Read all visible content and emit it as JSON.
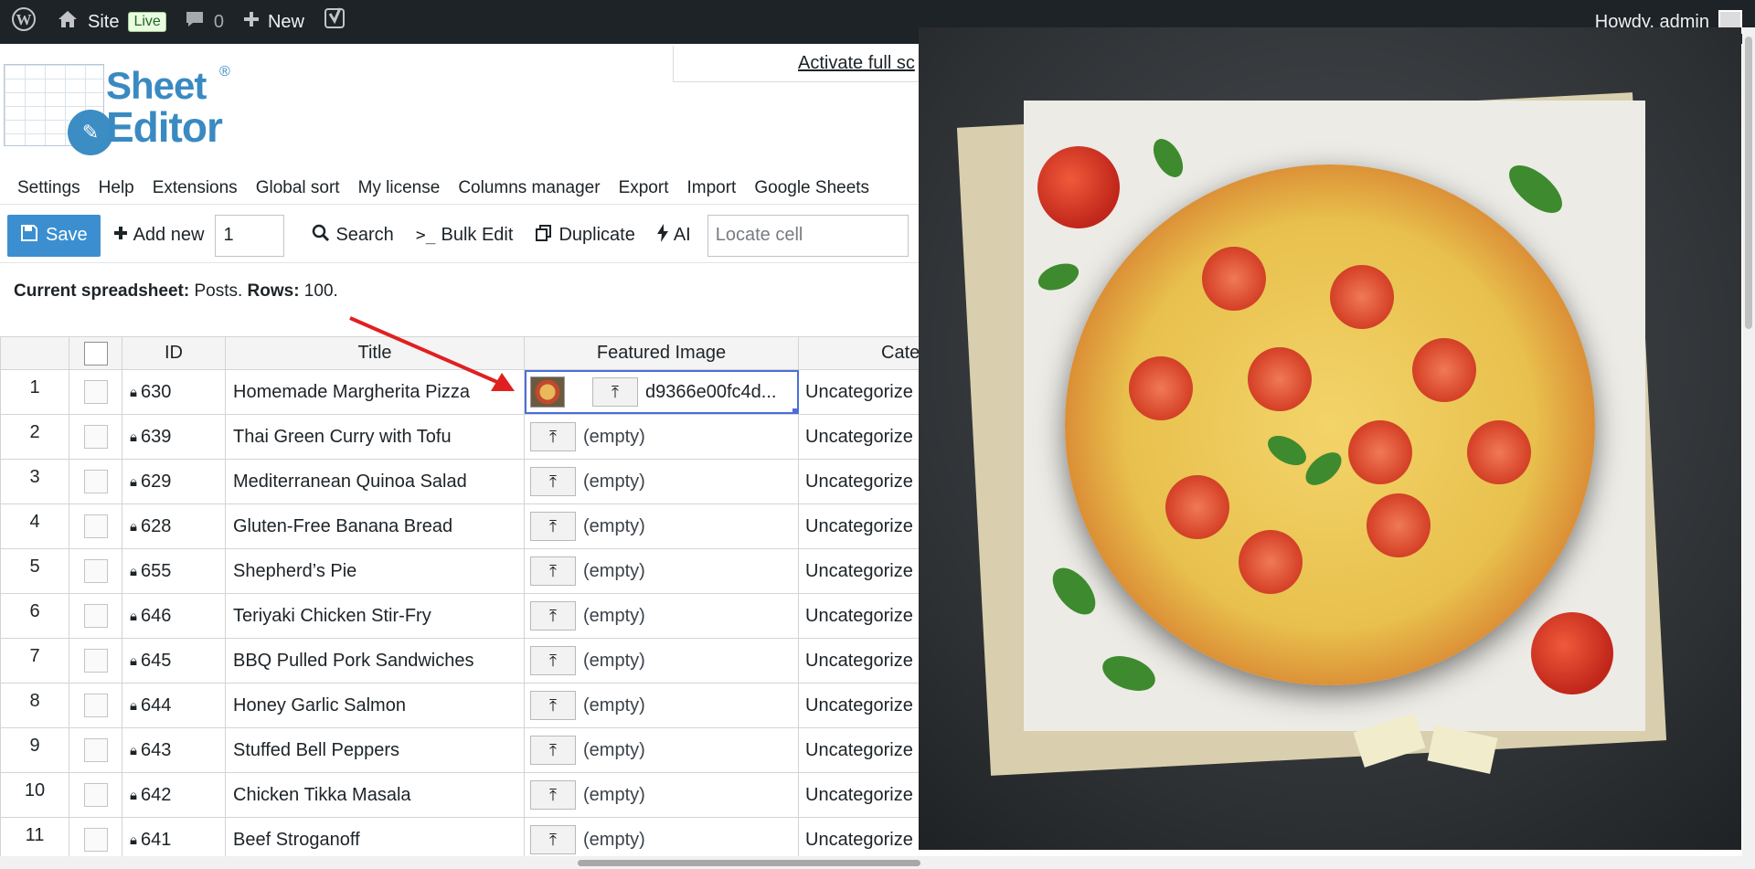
{
  "adminbar": {
    "site_label": "Site",
    "live_badge": "Live",
    "comments_count": "0",
    "new_label": "New",
    "howdy": "Howdy, admin"
  },
  "logo": {
    "word1": "Sheet",
    "word2": "Editor",
    "reg": "®"
  },
  "activate": {
    "label": "Activate full sc"
  },
  "menu": {
    "items": [
      "Settings",
      "Help",
      "Extensions",
      "Global sort",
      "My license",
      "Columns manager",
      "Export",
      "Import",
      "Google Sheets"
    ]
  },
  "toolbar": {
    "save_label": "Save",
    "add_new_label": "Add new",
    "add_new_count": "1",
    "search_label": "Search",
    "bulk_edit_label": "Bulk Edit",
    "duplicate_label": "Duplicate",
    "ai_label": "AI",
    "locate_placeholder": "Locate cell"
  },
  "summary": {
    "prefix": "Current spreadsheet:",
    "sheet": " Posts. ",
    "rows_label": "Rows:",
    "rows_value": " 100."
  },
  "table": {
    "headers": {
      "id": "ID",
      "title": "Title",
      "featured_image": "Featured Image",
      "category": "Catego"
    },
    "rows": [
      {
        "num": "1",
        "id": "630",
        "title": "Homemade Margherita Pizza",
        "image": "d9366e00fc4d...",
        "has_image": true,
        "category": "Uncategorize"
      },
      {
        "num": "2",
        "id": "639",
        "title": "Thai Green Curry with Tofu",
        "image": "(empty)",
        "category": "Uncategorize"
      },
      {
        "num": "3",
        "id": "629",
        "title": "Mediterranean Quinoa Salad",
        "image": "(empty)",
        "category": "Uncategorize"
      },
      {
        "num": "4",
        "id": "628",
        "title": "Gluten-Free Banana Bread",
        "image": "(empty)",
        "category": "Uncategorize"
      },
      {
        "num": "5",
        "id": "655",
        "title": "Shepherd’s Pie",
        "image": "(empty)",
        "category": "Uncategorize"
      },
      {
        "num": "6",
        "id": "646",
        "title": "Teriyaki Chicken Stir-Fry",
        "image": "(empty)",
        "category": "Uncategorize"
      },
      {
        "num": "7",
        "id": "645",
        "title": "BBQ Pulled Pork Sandwiches",
        "image": "(empty)",
        "category": "Uncategorize"
      },
      {
        "num": "8",
        "id": "644",
        "title": "Honey Garlic Salmon",
        "image": "(empty)",
        "category": "Uncategorize"
      },
      {
        "num": "9",
        "id": "643",
        "title": "Stuffed Bell Peppers",
        "image": "(empty)",
        "category": "Uncategorize"
      },
      {
        "num": "10",
        "id": "642",
        "title": "Chicken Tikka Masala",
        "image": "(empty)",
        "category": "Uncategorize"
      },
      {
        "num": "11",
        "id": "641",
        "title": "Beef Stroganoff",
        "image": "(empty)",
        "category": "Uncategorize"
      }
    ]
  },
  "icons": {
    "wordpress": "wordpress-icon",
    "home": "home-icon",
    "comment": "comment-icon",
    "plus": "plus-icon",
    "yoast": "yoast-icon",
    "save": "floppy-icon",
    "search": "search-icon",
    "bulk": "terminal-icon",
    "duplicate": "copy-icon",
    "ai": "bolt-icon",
    "lock": "lock-icon",
    "upload": "upload-icon"
  },
  "colors": {
    "adminbar_bg": "#1d2327",
    "brand_blue": "#3a8ac2",
    "save_button": "#3b8fd0",
    "selection": "#4b6fd8",
    "arrow": "#e02020"
  }
}
